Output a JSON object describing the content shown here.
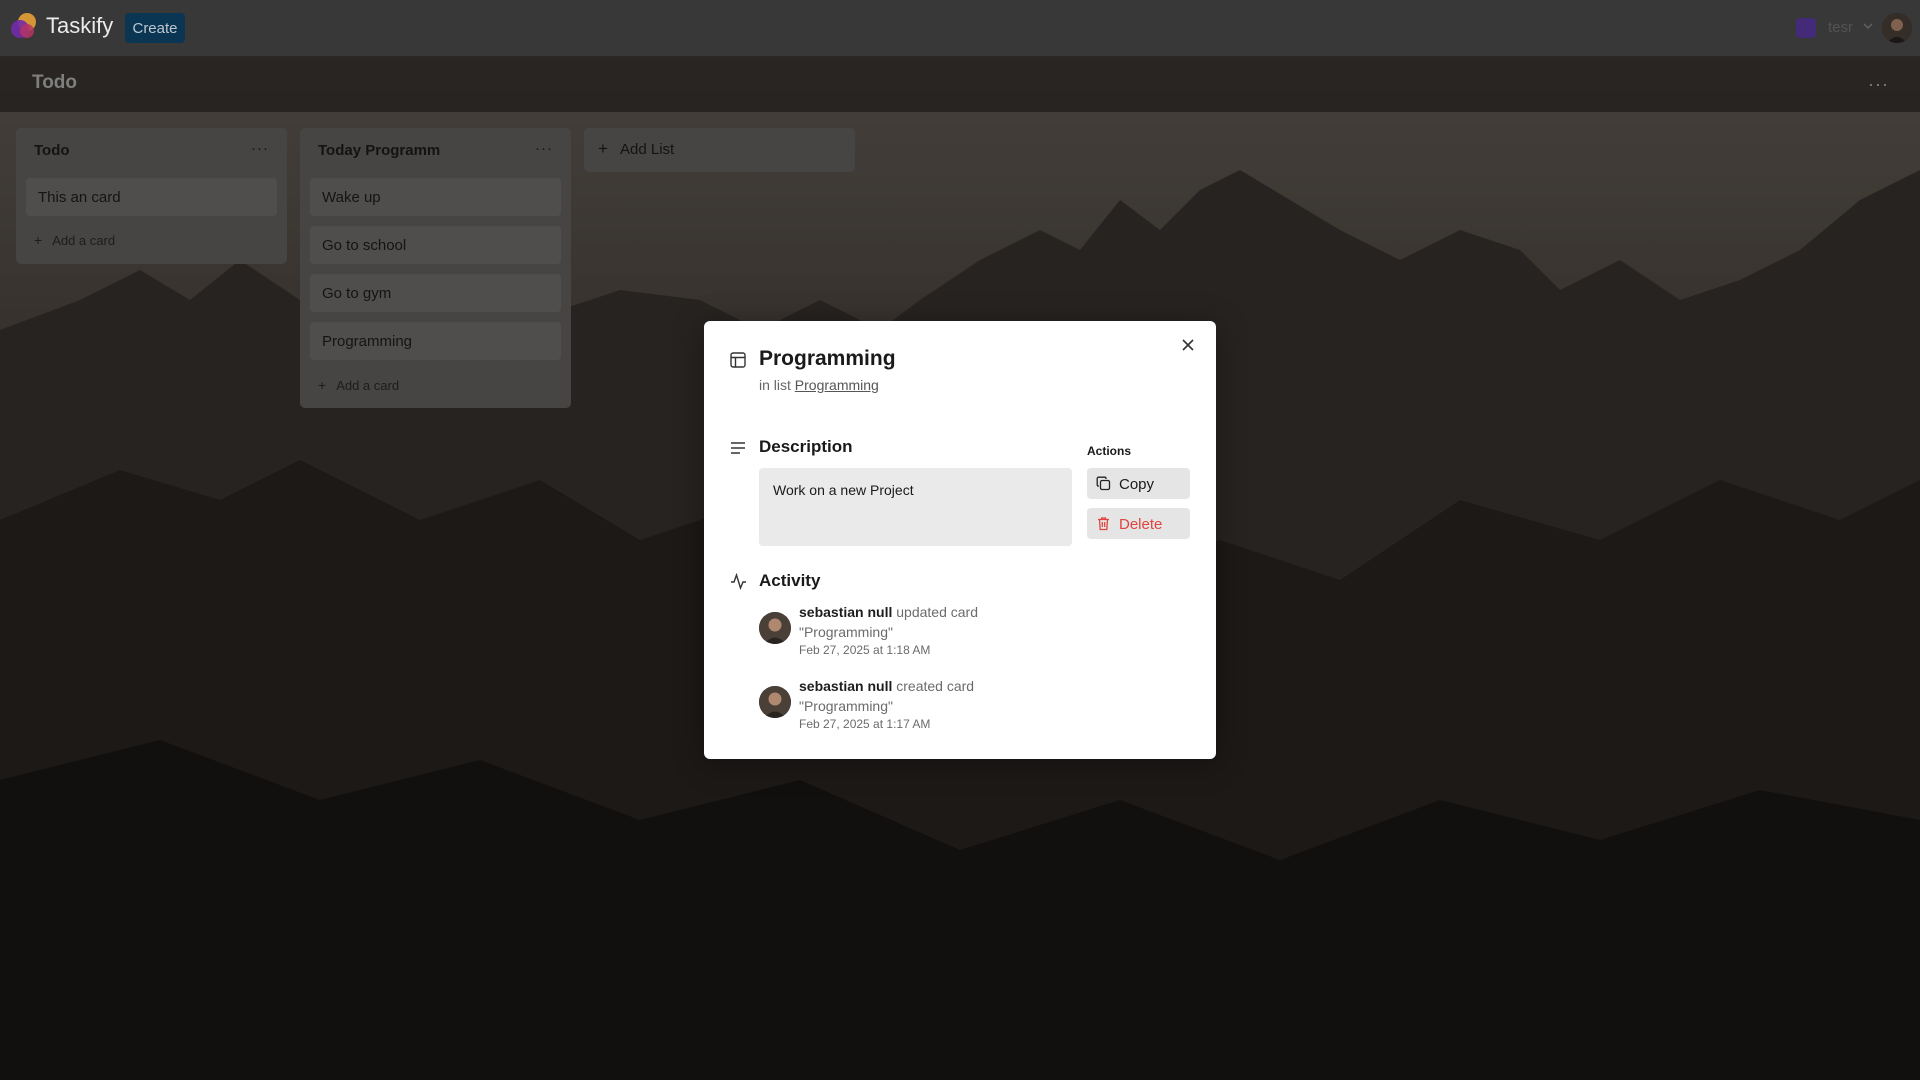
{
  "app": {
    "name": "Taskify",
    "create_label": "Create"
  },
  "org": {
    "name": "tesr"
  },
  "board": {
    "title": "Todo",
    "menu_label": "···"
  },
  "lists": [
    {
      "title": "Todo",
      "menu_label": "···",
      "cards": [
        "This an card"
      ],
      "add_card_label": "Add a card"
    },
    {
      "title": "Today Programm",
      "menu_label": "···",
      "cards": [
        "Wake up",
        "Go to school",
        "Go to gym",
        "Programming"
      ],
      "add_card_label": "Add a card"
    }
  ],
  "add_list_label": "Add List",
  "modal": {
    "title": "Programming",
    "in_list_prefix": "in list",
    "list_name": "Programming",
    "description_heading": "Description",
    "description_text": "Work on a new Project",
    "actions_heading": "Actions",
    "copy_label": "Copy",
    "delete_label": "Delete",
    "activity_heading": "Activity",
    "activity": [
      {
        "user": "sebastian null",
        "action": "updated card \"Programming\"",
        "time": "Feb 27, 2025 at 1:18 AM"
      },
      {
        "user": "sebastian null",
        "action": "created card \"Programming\"",
        "time": "Feb 27, 2025 at 1:17 AM"
      }
    ]
  },
  "colors": {
    "brand_button": "#0b3b5c",
    "delete": "#e0443e",
    "modal_bg": "#ffffff"
  },
  "icons": [
    "taskify-logo",
    "chevron-down-icon",
    "card-layout-icon",
    "close-icon",
    "description-lines-icon",
    "copy-icon",
    "trash-icon",
    "activity-pulse-icon",
    "plus-icon"
  ]
}
